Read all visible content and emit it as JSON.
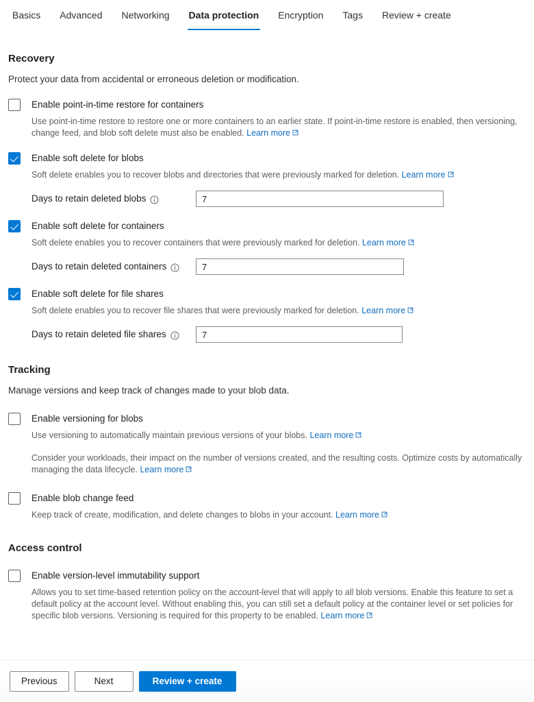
{
  "tabs": [
    {
      "label": "Basics",
      "active": false
    },
    {
      "label": "Advanced",
      "active": false
    },
    {
      "label": "Networking",
      "active": false
    },
    {
      "label": "Data protection",
      "active": true
    },
    {
      "label": "Encryption",
      "active": false
    },
    {
      "label": "Tags",
      "active": false
    },
    {
      "label": "Review + create",
      "active": false
    }
  ],
  "learn_more_label": "Learn more",
  "recovery": {
    "title": "Recovery",
    "subtitle": "Protect your data from accidental or erroneous deletion or modification.",
    "point_in_time": {
      "label": "Enable point-in-time restore for containers",
      "checked": false,
      "description": "Use point-in-time restore to restore one or more containers to an earlier state. If point-in-time restore is enabled, then versioning, change feed, and blob soft delete must also be enabled."
    },
    "soft_delete_blobs": {
      "label": "Enable soft delete for blobs",
      "checked": true,
      "description": "Soft delete enables you to recover blobs and directories that were previously marked for deletion.",
      "retain_label": "Days to retain deleted blobs",
      "retain_value": "7"
    },
    "soft_delete_containers": {
      "label": "Enable soft delete for containers",
      "checked": true,
      "description": "Soft delete enables you to recover containers that were previously marked for deletion.",
      "retain_label": "Days to retain deleted containers",
      "retain_value": "7"
    },
    "soft_delete_file_shares": {
      "label": "Enable soft delete for file shares",
      "checked": true,
      "description": "Soft delete enables you to recover file shares that were previously marked for deletion.",
      "retain_label": "Days to retain deleted file shares",
      "retain_value": "7"
    }
  },
  "tracking": {
    "title": "Tracking",
    "subtitle": "Manage versions and keep track of changes made to your blob data.",
    "versioning": {
      "label": "Enable versioning for blobs",
      "checked": false,
      "description": "Use versioning to automatically maintain previous versions of your blobs.",
      "description2": "Consider your workloads, their impact on the number of versions created, and the resulting costs. Optimize costs by automatically managing the data lifecycle."
    },
    "change_feed": {
      "label": "Enable blob change feed",
      "checked": false,
      "description": "Keep track of create, modification, and delete changes to blobs in your account."
    }
  },
  "access_control": {
    "title": "Access control",
    "immutability": {
      "label": "Enable version-level immutability support",
      "checked": false,
      "description": "Allows you to set time-based retention policy on the account-level that will apply to all blob versions. Enable this feature to set a default policy at the account level. Without enabling this, you can still set a default policy at the container level or set policies for specific blob versions. Versioning is required for this property to be enabled."
    }
  },
  "footer": {
    "previous_label": "Previous",
    "next_label": "Next",
    "review_label": "Review + create"
  },
  "colors": {
    "accent": "#0078d4",
    "link": "#0f6cbd",
    "text": "#201f1e",
    "muted": "#605e5c"
  }
}
